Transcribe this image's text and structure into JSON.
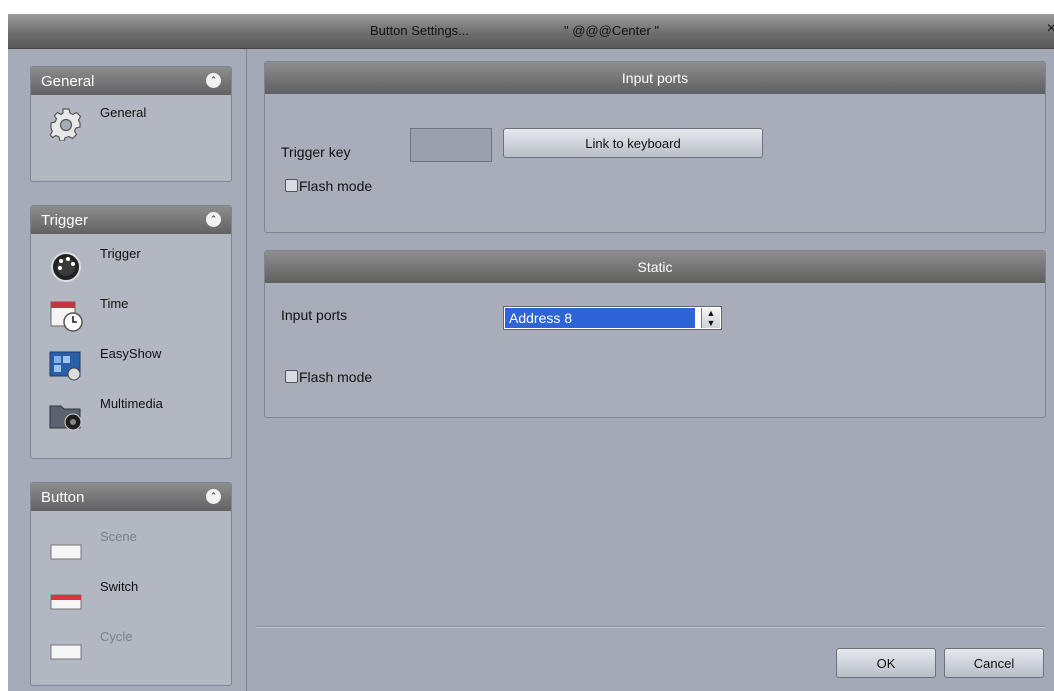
{
  "titlebar": {
    "title": "Button  Settings...",
    "subtitle": "\" @@@Center \"",
    "close_glyph": "×"
  },
  "sidebar": {
    "general": {
      "title": "General",
      "items": [
        {
          "label": "General",
          "icon": "gear-icon"
        }
      ]
    },
    "trigger": {
      "title": "Trigger",
      "items": [
        {
          "label": "Trigger",
          "icon": "dial-icon"
        },
        {
          "label": "Time",
          "icon": "calendar-clock-icon"
        },
        {
          "label": "EasyShow",
          "icon": "easyshow-icon"
        },
        {
          "label": "Multimedia",
          "icon": "folder-media-icon"
        }
      ]
    },
    "button": {
      "title": "Button",
      "items": [
        {
          "label": "Scene",
          "icon": "scene-button-icon",
          "enabled": false
        },
        {
          "label": "Switch",
          "icon": "switch-button-icon",
          "enabled": true
        },
        {
          "label": "Cycle",
          "icon": "cycle-button-icon",
          "enabled": false
        }
      ]
    }
  },
  "input_ports_section": {
    "title": "Input ports",
    "trigger_key_label": "Trigger key",
    "trigger_key_value": "",
    "link_button": "Link to keyboard",
    "flash_mode_label": "Flash mode",
    "flash_mode_checked": false
  },
  "static_section": {
    "title": "Static",
    "input_ports_label": "Input ports",
    "input_ports_value": "Address  8",
    "flash_mode_label": "Flash mode",
    "flash_mode_checked": false
  },
  "footer": {
    "ok": "OK",
    "cancel": "Cancel"
  },
  "colors": {
    "selection": "#2f63d8",
    "switch_accent": "#d8343a",
    "window_bg": "#a3a9b6"
  }
}
